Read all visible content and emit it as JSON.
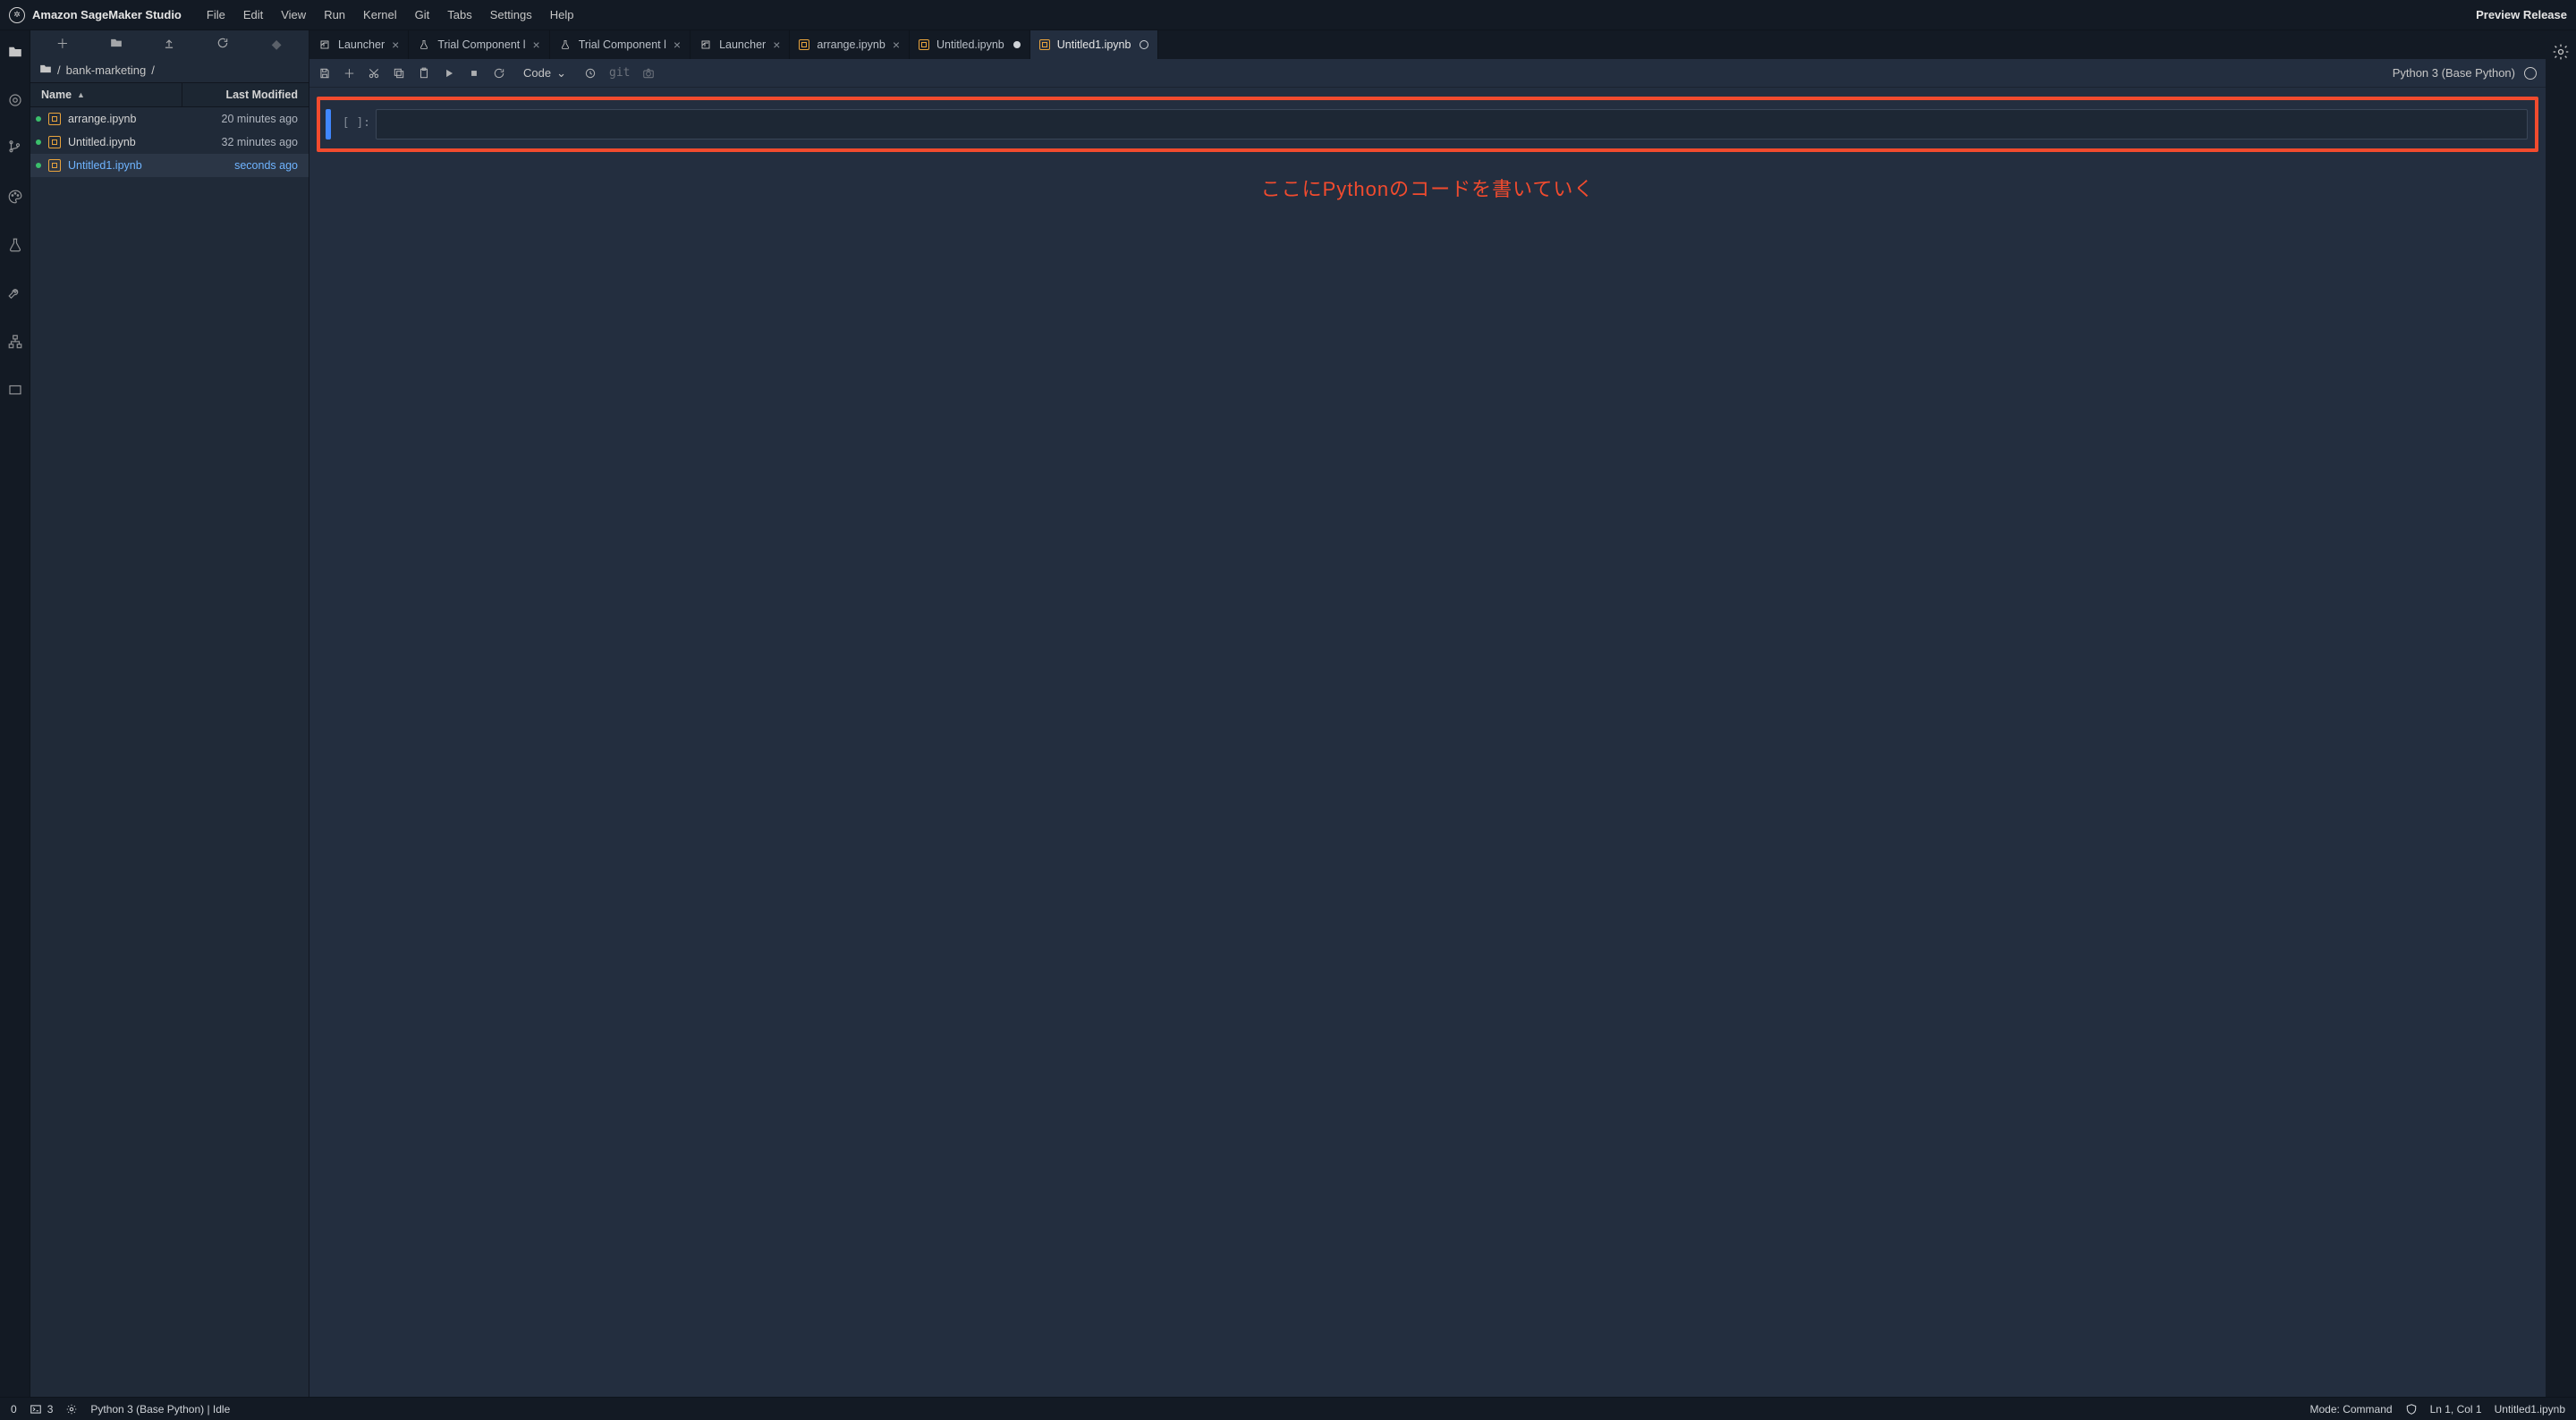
{
  "brand": "Amazon SageMaker Studio",
  "preview_label": "Preview Release",
  "menus": [
    "File",
    "Edit",
    "View",
    "Run",
    "Kernel",
    "Git",
    "Tabs",
    "Settings",
    "Help"
  ],
  "breadcrumb": {
    "sep1": "/",
    "folder": "bank-marketing",
    "sep2": "/"
  },
  "file_header": {
    "name": "Name",
    "modified": "Last Modified"
  },
  "files": [
    {
      "name": "arrange.ipynb",
      "modified": "20 minutes ago",
      "selected": false,
      "running": true
    },
    {
      "name": "Untitled.ipynb",
      "modified": "32 minutes ago",
      "selected": false,
      "running": true
    },
    {
      "name": "Untitled1.ipynb",
      "modified": "seconds ago",
      "selected": true,
      "running": true
    }
  ],
  "tabs": [
    {
      "label": "Launcher",
      "icon": "launcher",
      "close": true
    },
    {
      "label": "Trial Component l",
      "icon": "flask",
      "close": true
    },
    {
      "label": "Trial Component l",
      "icon": "flask",
      "close": true
    },
    {
      "label": "Launcher",
      "icon": "launcher",
      "close": true
    },
    {
      "label": "arrange.ipynb",
      "icon": "nb",
      "close": true
    },
    {
      "label": "Untitled.ipynb",
      "icon": "nb",
      "dirty": "dot"
    },
    {
      "label": "Untitled1.ipynb",
      "icon": "nb",
      "dirty": "ring",
      "active": true
    }
  ],
  "toolbar": {
    "celltype": "Code",
    "kernel": "Python 3 (Base Python)"
  },
  "cell": {
    "prompt": "[ ]:"
  },
  "annotation": "ここにPythonのコードを書いていく",
  "status": {
    "left_zero": "0",
    "terminals": "3",
    "kernel_status": "Python 3 (Base Python) | Idle",
    "mode": "Mode: Command",
    "ln_col": "Ln 1, Col 1",
    "filename": "Untitled1.ipynb"
  }
}
